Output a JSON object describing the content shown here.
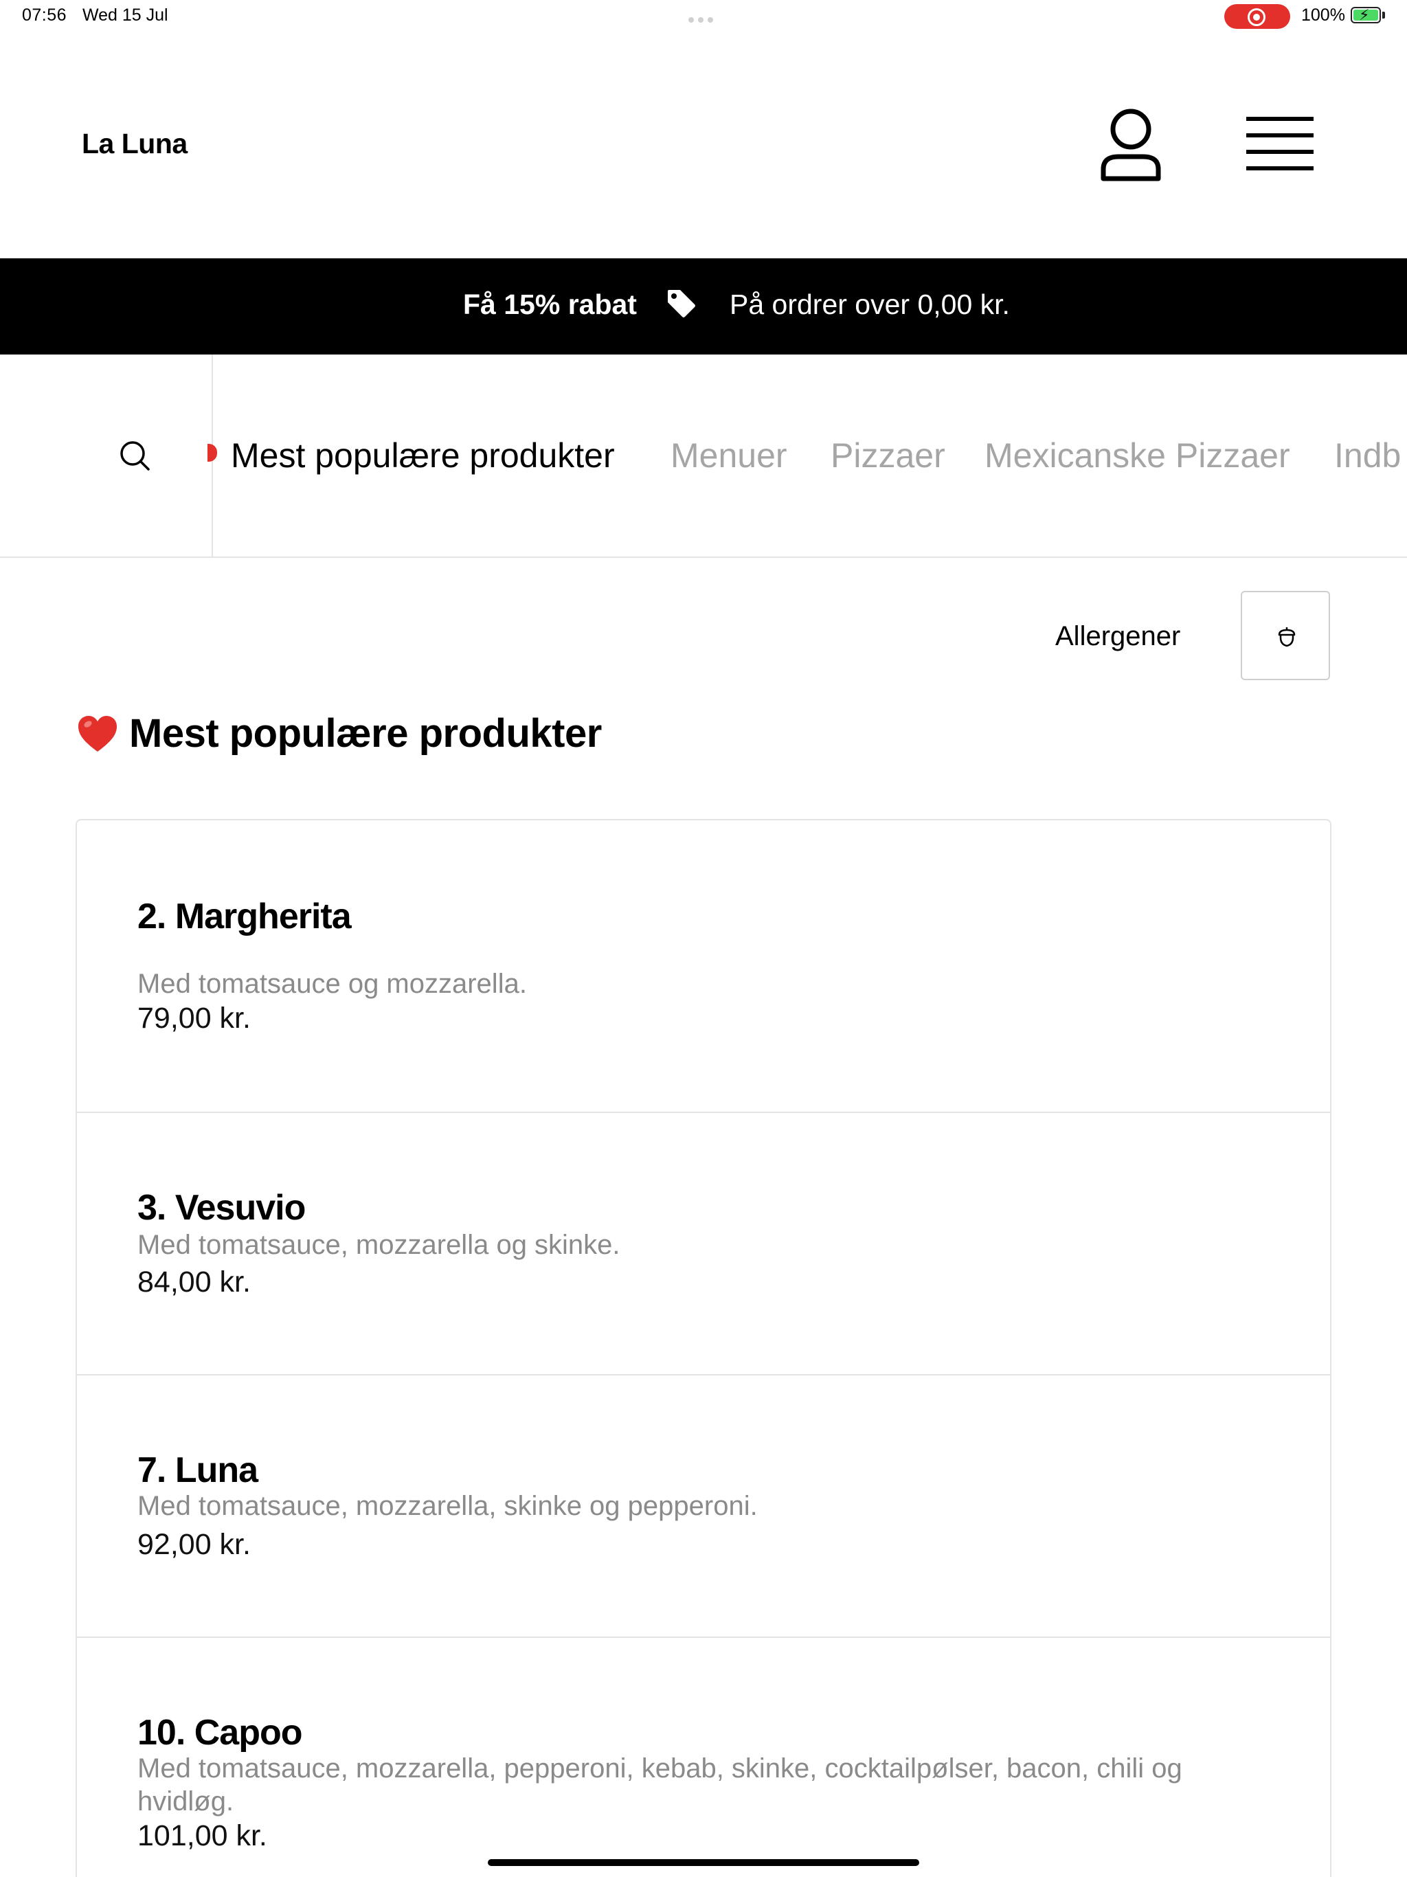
{
  "status_bar": {
    "time": "07:56",
    "date": "Wed 15 Jul",
    "battery_percent": "100%",
    "record_color": "#e3302b",
    "battery_color": "#4cd964"
  },
  "header": {
    "brand": "La Luna",
    "user_icon": "user-icon",
    "menu_icon": "hamburger-menu-icon"
  },
  "promo": {
    "title": "Få 15% rabat",
    "icon": "tag-icon",
    "text": "På ordrer over 0,00 kr."
  },
  "category_nav": {
    "search_icon": "search-icon",
    "tabs": [
      {
        "label": "Mest populære produkter",
        "active": true
      },
      {
        "label": "Menuer",
        "active": false
      },
      {
        "label": "Pizzaer",
        "active": false
      },
      {
        "label": "Mexicanske Pizzaer",
        "active": false
      },
      {
        "label": "Indb",
        "active": false
      }
    ]
  },
  "allergens": {
    "label": "Allergener",
    "icon": "acorn-icon"
  },
  "section": {
    "icon": "heart-icon",
    "title": "Mest populære produkter"
  },
  "products": [
    {
      "name": "2. Margherita",
      "description": "Med tomatsauce og mozzarella.",
      "price": "79,00 kr."
    },
    {
      "name": "3. Vesuvio",
      "description": "Med tomatsauce, mozzarella og skinke.",
      "price": "84,00 kr."
    },
    {
      "name": "7. Luna",
      "description": "Med tomatsauce, mozzarella, skinke og pepperoni.",
      "price": "92,00 kr."
    },
    {
      "name": "10. Capoo",
      "description": "Med tomatsauce, mozzarella, pepperoni, kebab, skinke, cocktailpølser, bacon, chili og hvidløg.",
      "price": "101,00 kr."
    }
  ]
}
